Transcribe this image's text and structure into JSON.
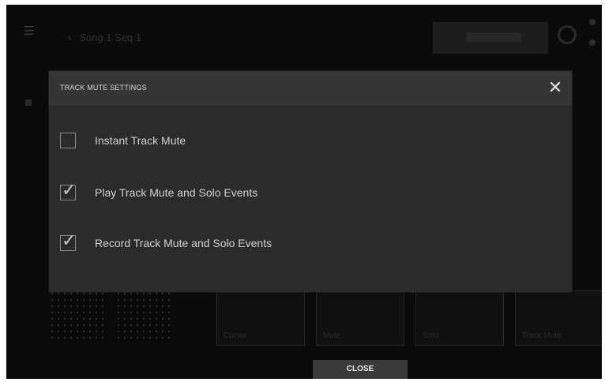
{
  "background": {
    "title": "Song 1 Seq 1",
    "pad_labels": [
      "Cursor",
      "Mute",
      "Solo",
      "Track Mute"
    ]
  },
  "modal": {
    "title": "TRACK MUTE SETTINGS",
    "close_icon": "close-icon",
    "options": [
      {
        "label": "Instant Track Mute",
        "checked": false
      },
      {
        "label": "Play Track Mute and Solo Events",
        "checked": true
      },
      {
        "label": "Record Track Mute and Solo Events",
        "checked": true
      }
    ]
  },
  "footer": {
    "close_label": "CLOSE"
  },
  "colors": {
    "screen_bg": "#0b0b0b",
    "modal_bg": "#2b2b2b",
    "modal_header": "#353535",
    "text": "#d2d2d2"
  }
}
